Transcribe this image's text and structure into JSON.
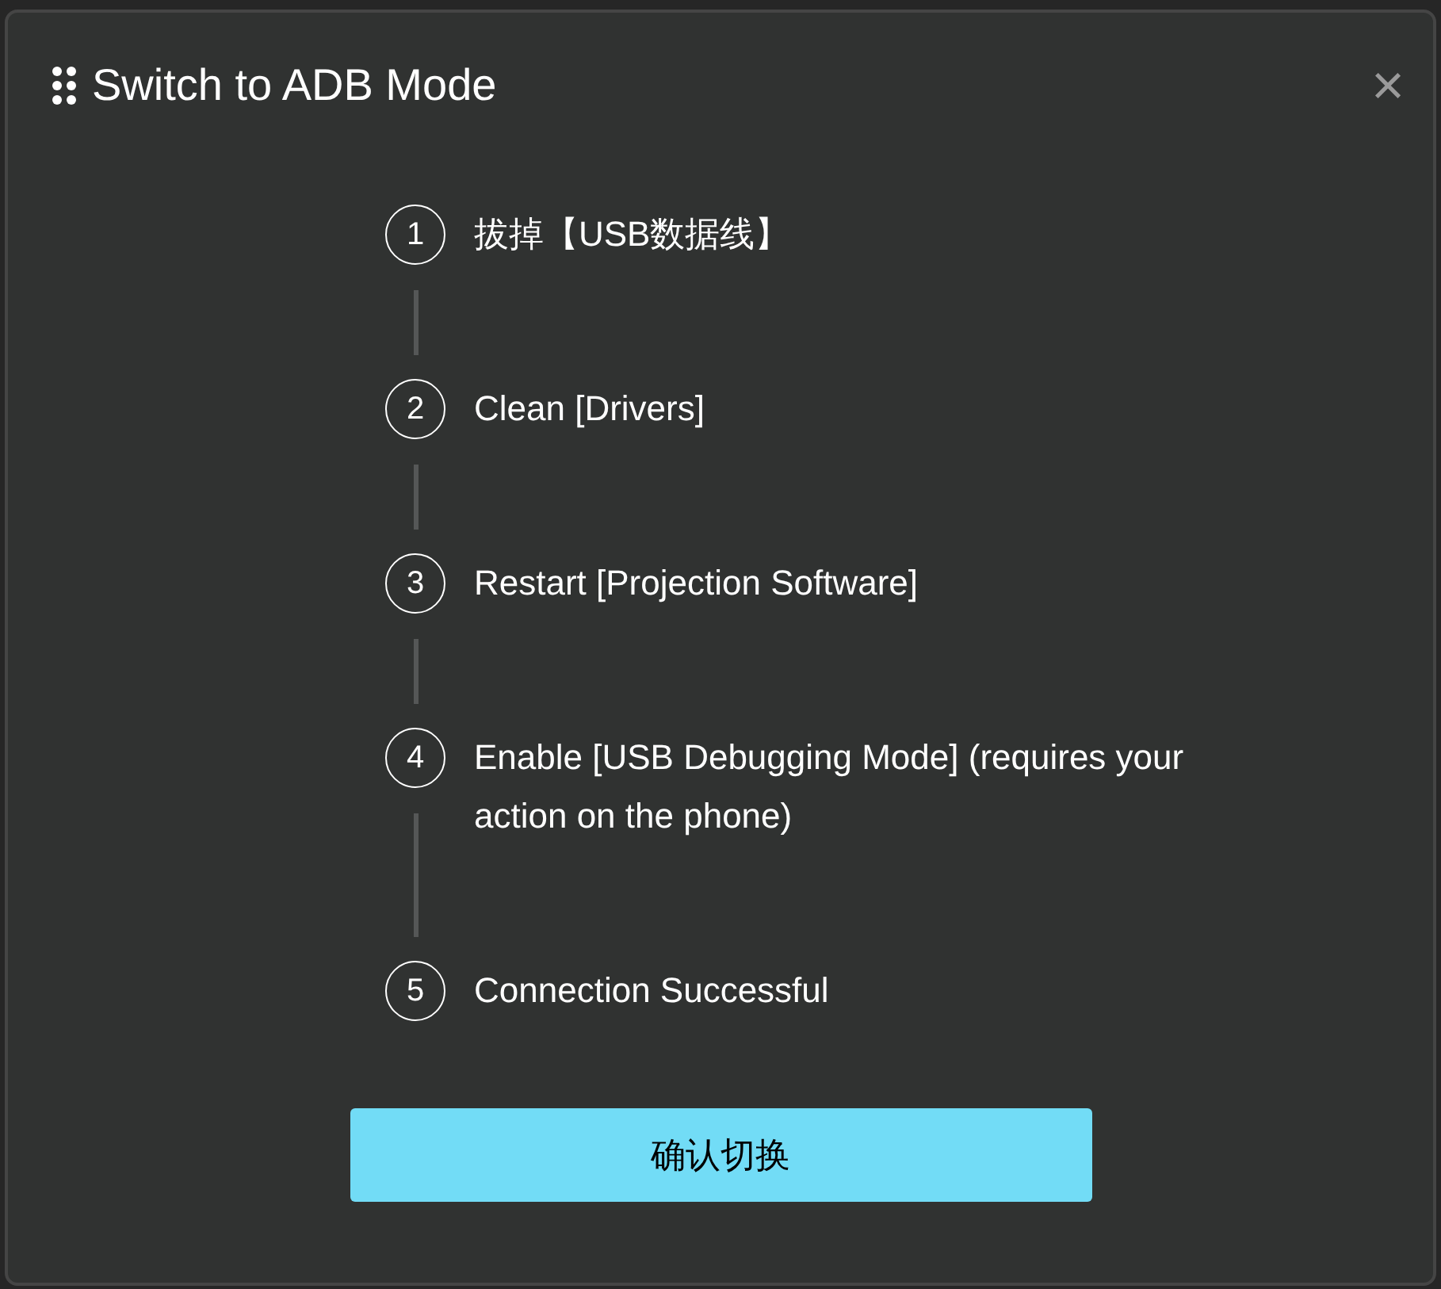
{
  "dialog": {
    "title": "Switch to ADB Mode",
    "close": "×"
  },
  "steps": [
    {
      "number": "1",
      "label": "拔掉【USB数据线】"
    },
    {
      "number": "2",
      "label": "Clean [Drivers]"
    },
    {
      "number": "3",
      "label": "Restart [Projection Software]"
    },
    {
      "number": "4",
      "label": "Enable [USB Debugging Mode] (requires your action on the phone)"
    },
    {
      "number": "5",
      "label": "Connection Successful"
    }
  ],
  "confirm_button": "确认切换"
}
